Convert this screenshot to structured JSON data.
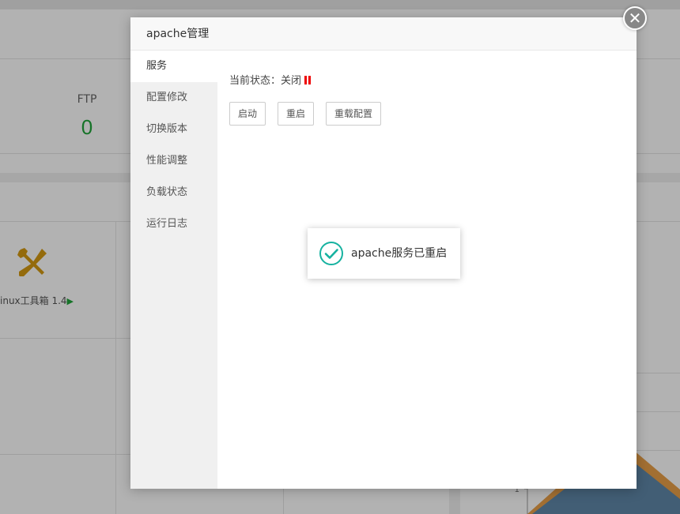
{
  "background": {
    "ftp_label": "FTP",
    "ftp_value": "0",
    "tool_label": "inux工具箱 1.4",
    "tool_arrow": "▶",
    "chart_tick": "1",
    "tool_icon": "wrench-screwdriver-icon"
  },
  "modal": {
    "title": "apache管理",
    "close_icon": "close-icon",
    "sidebar": [
      {
        "label": "服务",
        "active": true
      },
      {
        "label": "配置修改"
      },
      {
        "label": "切换版本"
      },
      {
        "label": "性能调整"
      },
      {
        "label": "负载状态"
      },
      {
        "label": "运行日志"
      }
    ],
    "status": {
      "prefix": "当前状态：关闭",
      "icon": "pause-icon",
      "icon_color": "#ee0000"
    },
    "buttons": {
      "start": "启动",
      "restart": "重启",
      "reload": "重载配置"
    }
  },
  "toast": {
    "icon": "check-circle-icon",
    "icon_color": "#16b2a0",
    "message": "apache服务已重启"
  }
}
